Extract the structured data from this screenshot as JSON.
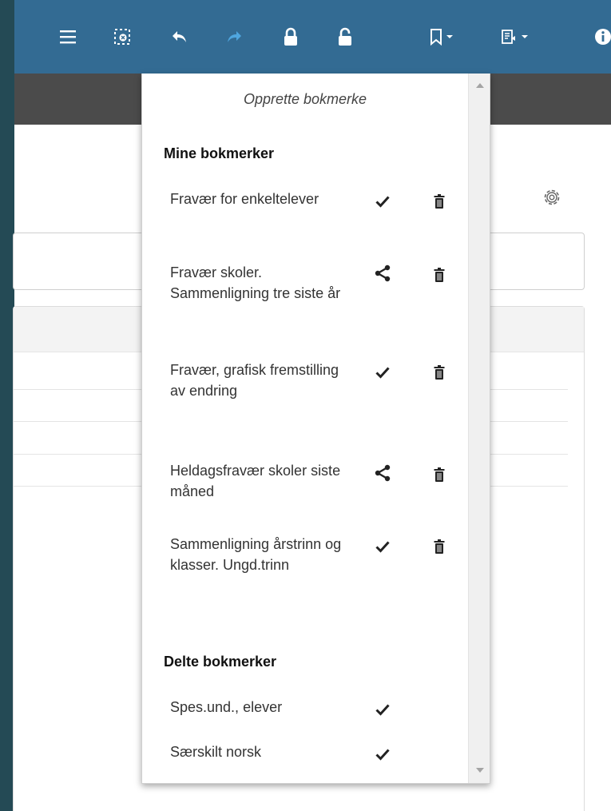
{
  "toolbar": {
    "buttons": [
      {
        "name": "menu-icon"
      },
      {
        "name": "clear-selections-icon"
      },
      {
        "name": "undo-icon"
      },
      {
        "name": "redo-icon"
      },
      {
        "name": "lock-icon"
      },
      {
        "name": "unlock-icon"
      },
      {
        "name": "bookmark-icon"
      },
      {
        "name": "report-icon"
      },
      {
        "name": "info-icon"
      }
    ],
    "accent": "#336b93",
    "disabled_color": "#4fa6df"
  },
  "bookmarks_menu": {
    "create_label": "Opprette bokmerke",
    "my_heading": "Mine bokmerker",
    "my_items": [
      {
        "label": "Fravær for enkeltelever",
        "status": "check-icon"
      },
      {
        "label": "Fravær skoler. Sammenligning tre siste år",
        "status": "share-icon"
      },
      {
        "label": "Fravær, grafisk fremstilling av endring",
        "status": "check-icon"
      },
      {
        "label": "Heldagsfravær skoler siste måned",
        "status": "share-icon"
      },
      {
        "label": "Sammenligning årstrinn og klasser. Ungd.trinn",
        "status": "check-icon"
      }
    ],
    "shared_heading": "Delte bokmerker",
    "shared_items": [
      {
        "label": "Spes.und., elever",
        "status": "check-icon"
      },
      {
        "label": "Særskilt norsk",
        "status": "check-icon"
      }
    ]
  },
  "colors": {
    "background": "#244a55",
    "subbar": "#4b4b4b"
  }
}
